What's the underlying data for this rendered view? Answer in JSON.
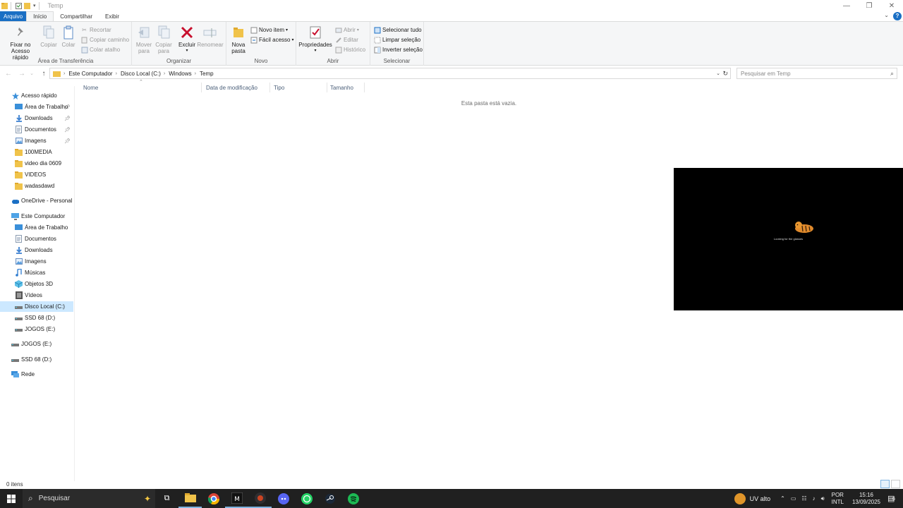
{
  "window": {
    "title": "Temp",
    "controls": [
      "minimize-icon",
      "restore-icon",
      "close-icon"
    ]
  },
  "tabs": [
    "Arquivo",
    "Início",
    "Compartilhar",
    "Exibir"
  ],
  "ribbon": {
    "clipboard": {
      "label": "Área de Transferência",
      "pin": "Fixar no\nAcesso rápido",
      "pin_l1": "Fixar no",
      "pin_l2": "Acesso rápido",
      "copy": "Copiar",
      "paste": "Colar",
      "cut": "Recortar",
      "copy_path": "Copiar caminho",
      "paste_shortcut": "Colar atalho"
    },
    "organize": {
      "label": "Organizar",
      "move_l1": "Mover",
      "move_l2": "para",
      "copyto_l1": "Copiar",
      "copyto_l2": "para",
      "delete": "Excluir",
      "rename": "Renomear"
    },
    "new": {
      "label": "Novo",
      "folder_l1": "Nova",
      "folder_l2": "pasta",
      "new_item": "Novo item",
      "easy_access": "Fácil acesso"
    },
    "open": {
      "label": "Abrir",
      "properties": "Propriedades",
      "open": "Abrir",
      "edit": "Editar",
      "history": "Histórico"
    },
    "select": {
      "label": "Selecionar",
      "select_all": "Selecionar tudo",
      "clear": "Limpar seleção",
      "invert": "Inverter seleção"
    }
  },
  "address": {
    "crumbs": [
      "Este Computador",
      "Disco Local (C:)",
      "Windows",
      "Temp"
    ],
    "search_placeholder": "Pesquisar em Temp"
  },
  "navpane": {
    "items": [
      {
        "label": "Acesso rápido",
        "icon": "star-icon"
      },
      {
        "label": "Área de Trabalho",
        "icon": "desktop-icon",
        "pinned": true
      },
      {
        "label": "Downloads",
        "icon": "download-icon",
        "pinned": true
      },
      {
        "label": "Documentos",
        "icon": "document-icon",
        "pinned": true
      },
      {
        "label": "Imagens",
        "icon": "pictures-icon",
        "pinned": true
      },
      {
        "label": "100MEDIA",
        "icon": "folder-icon"
      },
      {
        "label": "video dia 0609",
        "icon": "folder-icon"
      },
      {
        "label": "VIDEOS",
        "icon": "folder-icon"
      },
      {
        "label": "wadasdawd",
        "icon": "folder-icon"
      },
      {
        "label": "OneDrive - Personal",
        "icon": "cloud-icon"
      },
      {
        "label": "Este Computador",
        "icon": "computer-icon"
      },
      {
        "label": "Área de Trabalho",
        "icon": "desktop-icon"
      },
      {
        "label": "Documentos",
        "icon": "document-icon"
      },
      {
        "label": "Downloads",
        "icon": "download-icon"
      },
      {
        "label": "Imagens",
        "icon": "pictures-icon"
      },
      {
        "label": "Músicas",
        "icon": "music-icon"
      },
      {
        "label": "Objetos 3D",
        "icon": "cube-icon"
      },
      {
        "label": "Vídeos",
        "icon": "video-icon"
      },
      {
        "label": "Disco Local (C:)",
        "icon": "drive-icon",
        "selected": true
      },
      {
        "label": "SSD 68 (D:)",
        "icon": "drive-icon"
      },
      {
        "label": "JOGOS (E:)",
        "icon": "drive-icon"
      },
      {
        "label": "JOGOS (E:)",
        "icon": "drive-icon"
      },
      {
        "label": "SSD 68 (D:)",
        "icon": "drive-icon"
      },
      {
        "label": "Rede",
        "icon": "network-icon"
      }
    ]
  },
  "columns": [
    "Nome",
    "Data de modificação",
    "Tipo",
    "Tamanho"
  ],
  "empty_message": "Esta pasta está vazia.",
  "video_overlay": {
    "caption": "Looking for the glasses"
  },
  "status": {
    "item_count": "0 itens"
  },
  "taskbar": {
    "search_label": "Pesquisar",
    "apps": [
      "task-view-icon",
      "file-explorer-icon",
      "chrome-icon",
      "capcut-icon",
      "obs-icon",
      "discord-icon",
      "whatsapp-icon",
      "steam-icon",
      "spotify-icon"
    ],
    "weather": "UV alto",
    "lang_l1": "POR",
    "lang_l2": "INTL",
    "time": "15:16",
    "date": "13/09/2025",
    "notifications": "6"
  },
  "colors": {
    "accent": "#1a6fc4",
    "selected": "#cce8ff",
    "taskbar": "#202020"
  }
}
